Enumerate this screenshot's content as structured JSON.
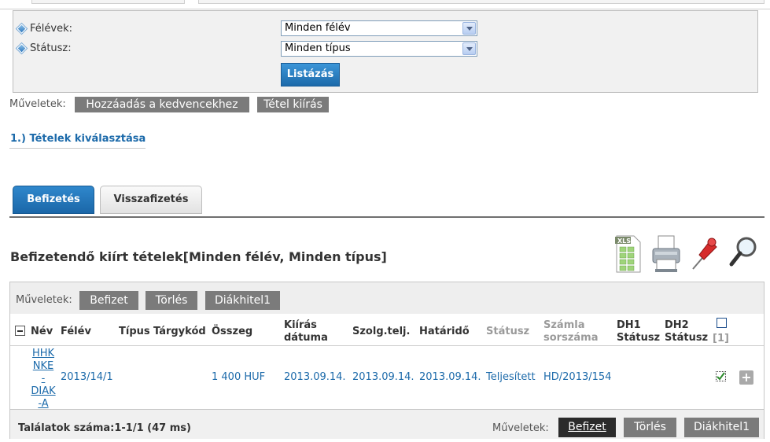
{
  "filters": {
    "semesters_label": "Félévek:",
    "semesters_value": "Minden félév",
    "status_label": "Státusz:",
    "status_value": "Minden típus",
    "list_button": "Listázás"
  },
  "top_actions": {
    "label": "Műveletek:",
    "favorites_button": "Hozzáadás a kedvencekhez",
    "print_button": "Tétel kiírás"
  },
  "step_link": "1.) Tételek kiválasztása",
  "tabs": [
    {
      "label": "Befizetés",
      "active": true
    },
    {
      "label": "Visszafizetés",
      "active": false
    }
  ],
  "section_title": "Befizetendő kiírt tételek[Minden félév, Minden típus]",
  "toolbar_icons": [
    "xls-export-icon",
    "printer-icon",
    "pin-icon",
    "magnifier-icon"
  ],
  "grid_actions": {
    "label": "Műveletek:",
    "pay_button": "Befizet",
    "delete_button": "Törlés",
    "loan_button": "Diákhitel1"
  },
  "columns": {
    "name": "Név",
    "semester": "Félév",
    "type": "Típus",
    "subject_code": "Tárgykód",
    "amount": "Összeg",
    "issue_date_1": "Kiírás",
    "issue_date_2": "dátuma",
    "service_date": "Szolg.telj.",
    "deadline": "Határidő",
    "status": "Státusz",
    "invoice_1": "Számla",
    "invoice_2": "sorszáma",
    "dh1_1": "DH1",
    "dh1_2": "Státusz",
    "dh2_1": "DH2",
    "dh2_2": "Státusz",
    "select_count": "[1]"
  },
  "rows": [
    {
      "name_lines": [
        "HHK",
        "NKE",
        "-",
        "DIAK",
        "-A"
      ],
      "semester": "2013/14/1",
      "type": "",
      "subject_code": "",
      "amount": "1 400 HUF",
      "issue_date": "2013.09.14.",
      "service_date": "2013.09.14.",
      "deadline": "2013.09.14.",
      "status": "Teljesített",
      "invoice": "HD/2013/154",
      "checked": true
    }
  ],
  "footer": {
    "results": "Találatok száma:1-1/1 (47 ms)",
    "label": "Műveletek:",
    "pay_button": "Befizet",
    "delete_button": "Törlés",
    "loan_button": "Diákhitel1"
  }
}
